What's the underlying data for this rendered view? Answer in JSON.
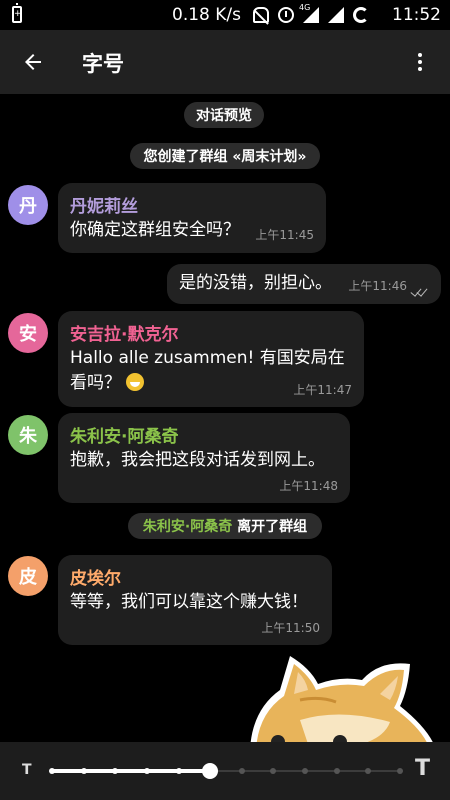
{
  "status_bar": {
    "battery_left_symbol": "+",
    "net_speed": "0.18 K/s",
    "network_label": "4G",
    "time": "11:52"
  },
  "app_bar": {
    "title": "字号"
  },
  "chat": {
    "preview_pill": "对话预览",
    "created_pill": "您创建了群组 «周末计划»",
    "left_pill_name": "朱利安·阿桑奇",
    "left_pill_text": " 离开了群组",
    "messages": [
      {
        "avatar": "丹",
        "sender": "丹妮莉丝",
        "sender_color": "#b39ddb",
        "avatar_color": "#9f8fe8",
        "text": "你确定这群组安全吗？",
        "time": "上午11:45"
      },
      {
        "text": "是的没错，别担心。",
        "time": "上午11:46",
        "outgoing": true
      },
      {
        "avatar": "安",
        "sender": "安吉拉·默克尔",
        "sender_color": "#f06292",
        "avatar_color": "#e5679a",
        "text": "Hallo alle zusammen! 有国安局在看吗？",
        "time": "上午11:47"
      },
      {
        "avatar": "朱",
        "sender": "朱利安·阿桑奇",
        "sender_color": "#8bc34a",
        "avatar_color": "#7fc36a",
        "text": "抱歉，我会把这段对话发到网上。",
        "time": "上午11:48"
      },
      {
        "avatar": "皮",
        "sender": "皮埃尔",
        "sender_color": "#ffab6b",
        "avatar_color": "#f4a06a",
        "text": "等等，我们可以靠这个赚大钱！",
        "time": "上午11:50"
      }
    ]
  },
  "font_slider": {
    "small_label": "T",
    "large_label": "T",
    "steps": 12,
    "selected_step": 5
  },
  "icons": {
    "back": "arrow-left-icon",
    "more": "more-vertical-icon"
  }
}
